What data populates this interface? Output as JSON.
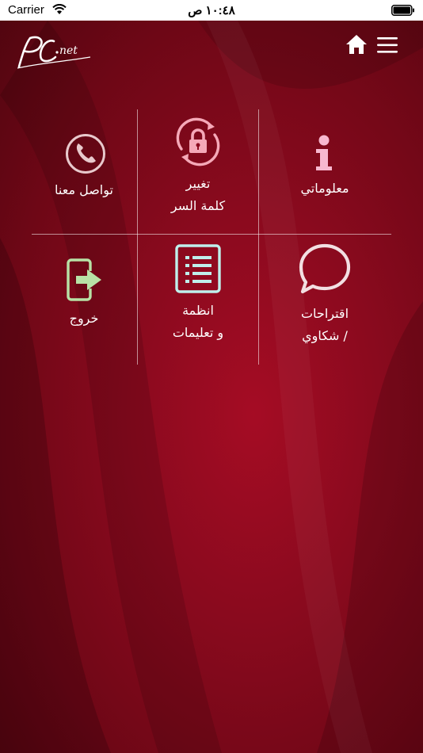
{
  "status_bar": {
    "carrier": "Carrier",
    "time": "١٠:٤٨ ص"
  },
  "header": {
    "logo_text": "PC.net",
    "home_icon": "home-icon",
    "menu_icon": "hamburger-menu-icon"
  },
  "menu": {
    "items": [
      {
        "id": "info",
        "line1": "معلوماتي",
        "line2": "",
        "icon": "info-icon",
        "color": "#f7b8cf"
      },
      {
        "id": "password",
        "line1": "تغيير",
        "line2": "كلمة السر",
        "icon": "lock-refresh-icon",
        "color": "#f5a9b8"
      },
      {
        "id": "contact",
        "line1": "تواصل معنا",
        "line2": "",
        "icon": "phone-icon",
        "color": "#e8c9cc"
      },
      {
        "id": "suggestions",
        "line1": "اقتراحات",
        "line2": "/ شكاوي",
        "icon": "chat-bubble-icon",
        "color": "#f2dfe2"
      },
      {
        "id": "rules",
        "line1": "انظمة",
        "line2": "و تعليمات",
        "icon": "list-icon",
        "color": "#bff0ec"
      },
      {
        "id": "logout",
        "line1": "خروج",
        "line2": "",
        "icon": "exit-icon",
        "color": "#b8e2a6"
      }
    ]
  },
  "colors": {
    "background": "#8a0a1e",
    "status_bar": "#ffffff",
    "text": "#ffffff"
  }
}
